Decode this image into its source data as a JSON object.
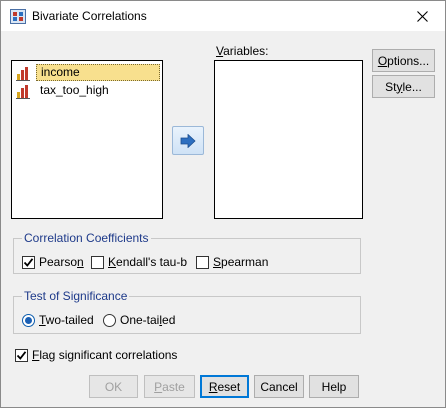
{
  "window": {
    "title": "Bivariate Correlations"
  },
  "source_list": {
    "items": [
      {
        "label": "income",
        "selected": true
      },
      {
        "label": "tax_too_high",
        "selected": false
      }
    ]
  },
  "variables": {
    "label_pre": "",
    "label_ul": "V",
    "label_post": "ariables:"
  },
  "buttons": {
    "options": {
      "pre": "",
      "ul": "O",
      "post": "ptions..."
    },
    "style": {
      "pre": "St",
      "ul": "y",
      "post": "le..."
    },
    "ok": "OK",
    "paste": {
      "pre": "",
      "ul": "P",
      "post": "aste"
    },
    "reset": {
      "pre": "",
      "ul": "R",
      "post": "eset"
    },
    "cancel": "Cancel",
    "help": "Help"
  },
  "correlation_coefficients": {
    "title": "Correlation Coefficients",
    "pearson": {
      "pre": "Pearso",
      "ul": "n",
      "post": "",
      "checked": true
    },
    "kendall": {
      "pre": "",
      "ul": "K",
      "post": "endall's tau-b",
      "checked": false
    },
    "spearman": {
      "pre": "",
      "ul": "S",
      "post": "pearman",
      "checked": false
    }
  },
  "test_of_significance": {
    "title": "Test of Significance",
    "two_tailed": {
      "pre": "",
      "ul": "T",
      "post": "wo-tailed",
      "checked": true
    },
    "one_tailed": {
      "pre": "One-tai",
      "ul": "l",
      "post": "ed",
      "checked": false
    }
  },
  "flag": {
    "pre": "",
    "ul": "F",
    "post": "lag significant correlations",
    "checked": true
  },
  "colors": {
    "accent": "#0078d7",
    "selection": "#f8e08e",
    "group_title": "#1e3a8a"
  }
}
